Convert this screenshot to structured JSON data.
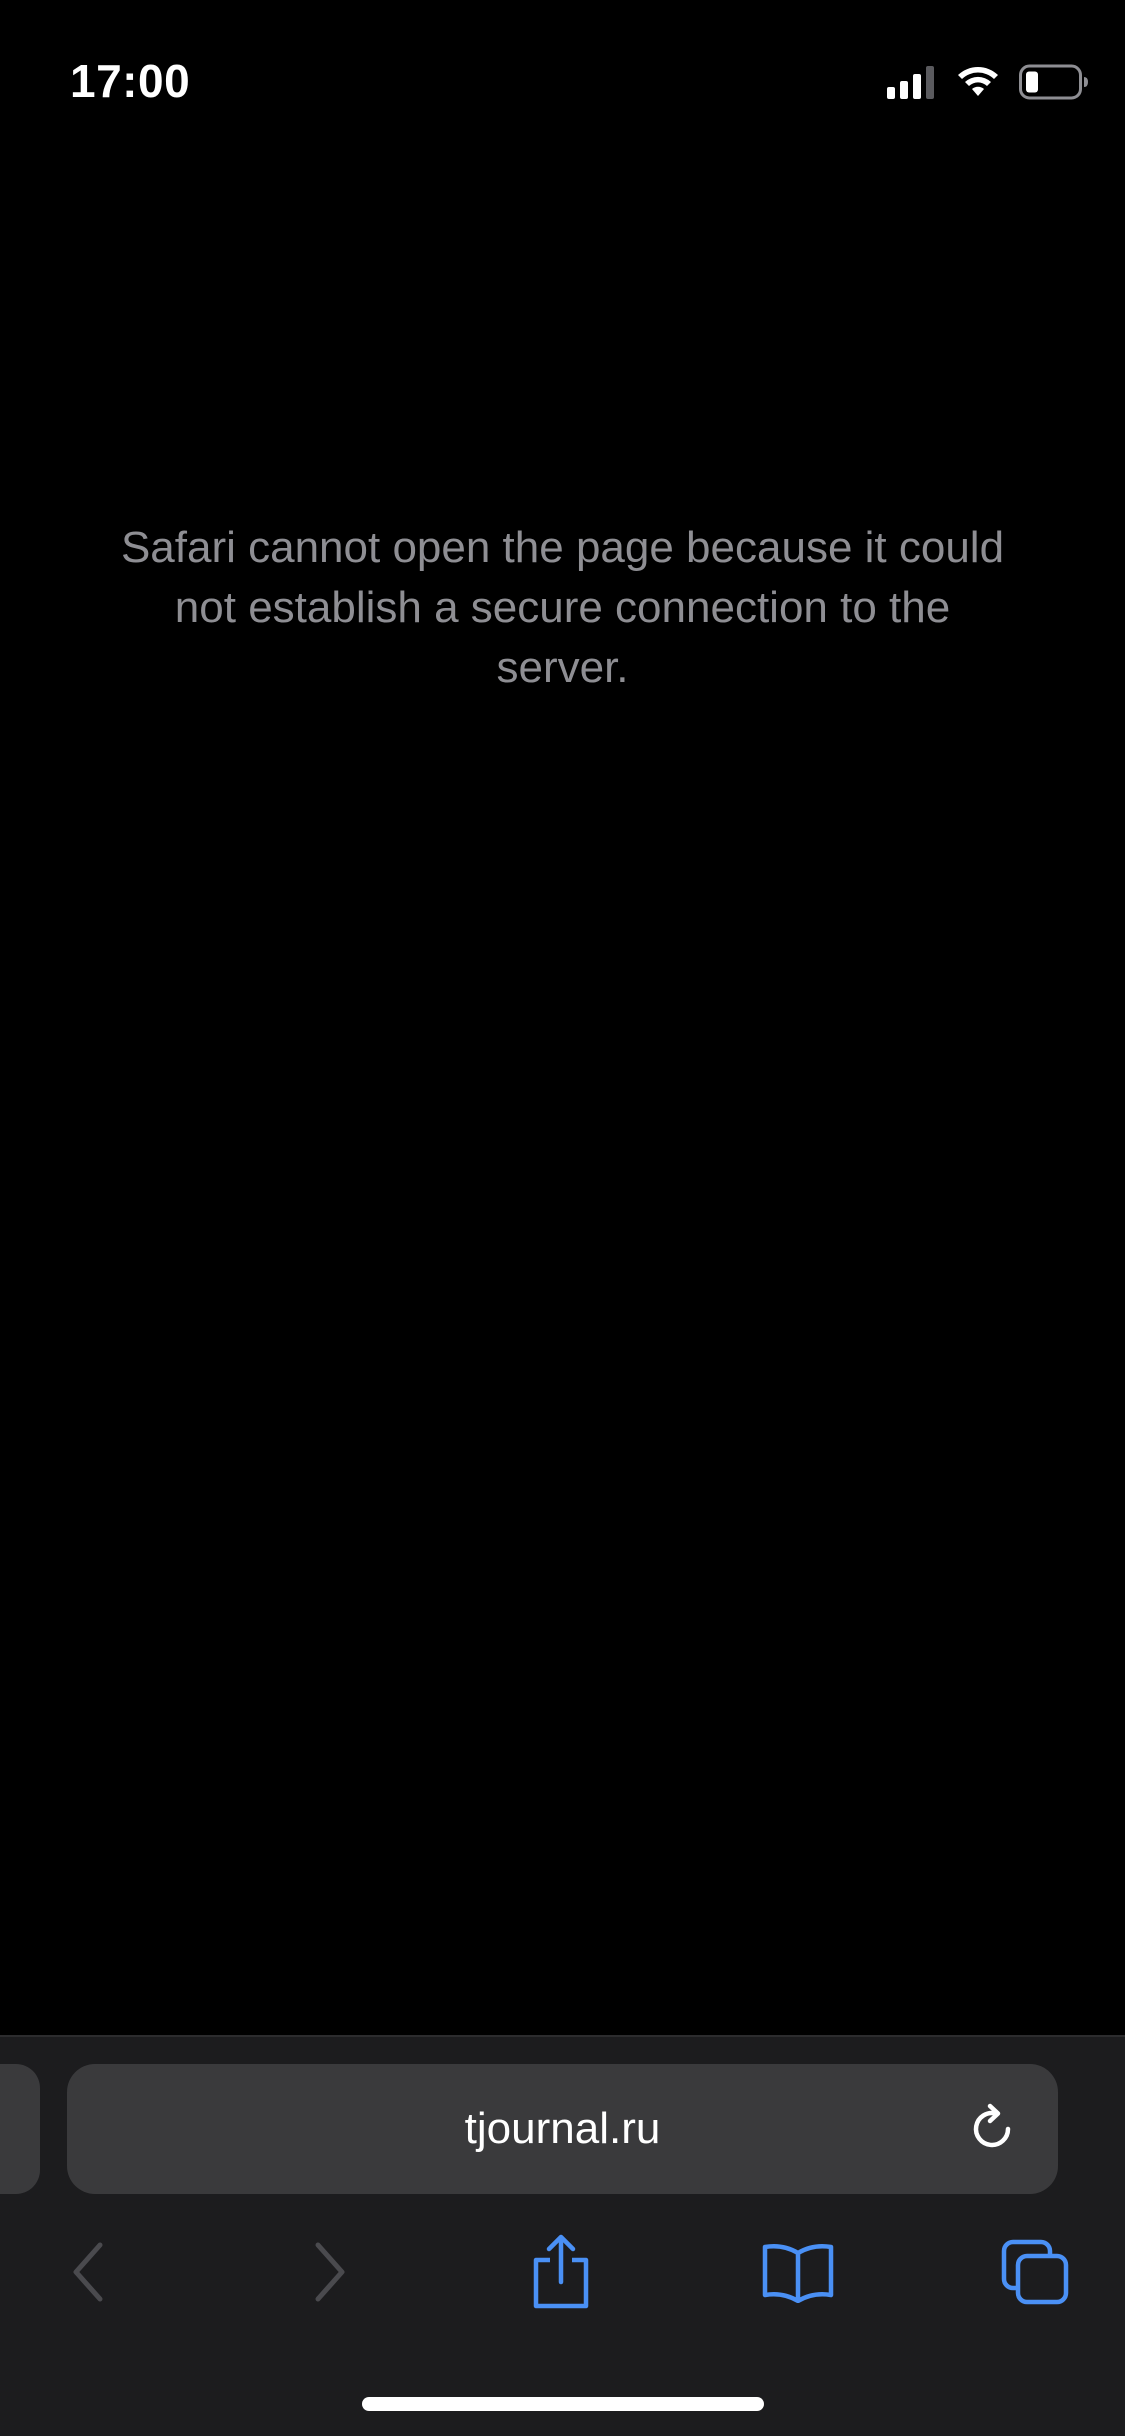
{
  "status_bar": {
    "time": "17:00",
    "icons": [
      "cellular-signal-icon",
      "wifi-icon",
      "battery-icon"
    ]
  },
  "content": {
    "error_message": "Safari cannot open the page because it could not establish a secure connection to the server."
  },
  "address_bar": {
    "url": "tjournal.ru"
  },
  "toolbar": {
    "buttons": [
      "back-icon",
      "forward-icon",
      "share-icon",
      "bookmarks-icon",
      "tabs-icon"
    ]
  },
  "colors": {
    "background": "#000000",
    "toolbar_background": "#1c1c1e",
    "address_field": "#3a3a3c",
    "accent": "#4a90f5",
    "secondary_text": "#8e8e93",
    "disabled_icon": "#4a4a4e"
  }
}
